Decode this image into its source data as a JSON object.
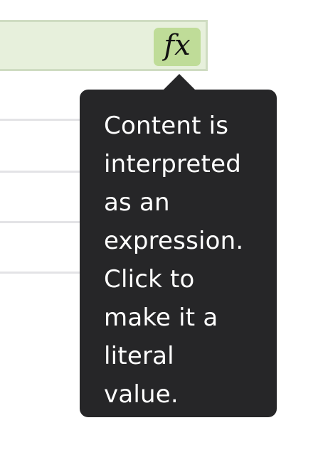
{
  "expression_field": {
    "fx_button": {
      "label": "fx",
      "icon": "function-fx-icon"
    }
  },
  "tooltip": {
    "text": "Content is\ninterpreted\nas an\nexpression.\nClick to\nmake it a\nliteral\nvalue."
  },
  "colors": {
    "field_background": "#e7f0dc",
    "field_border": "#cfdcc2",
    "fx_button_background": "#bfdc98",
    "tooltip_background": "#262628",
    "tooltip_text": "#ffffff",
    "separator": "#e3e3e6"
  }
}
